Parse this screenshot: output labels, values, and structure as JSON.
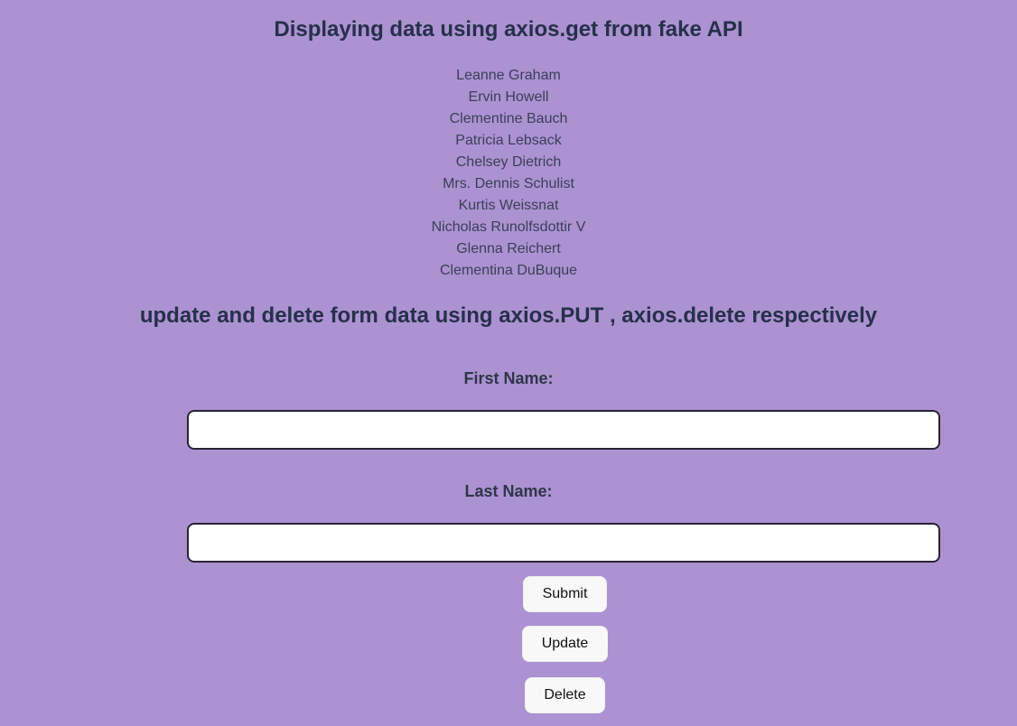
{
  "header": {
    "title": "Displaying data using axios.get from fake API"
  },
  "users": [
    "Leanne Graham",
    "Ervin Howell",
    "Clementine Bauch",
    "Patricia Lebsack",
    "Chelsey Dietrich",
    "Mrs. Dennis Schulist",
    "Kurtis Weissnat",
    "Nicholas Runolfsdottir V",
    "Glenna Reichert",
    "Clementina DuBuque"
  ],
  "form": {
    "title": "update and delete form data using axios.PUT , axios.delete respectively",
    "first_name_label": "First Name:",
    "first_name_value": "",
    "last_name_label": "Last Name:",
    "last_name_value": "",
    "submit_label": "Submit",
    "update_label": "Update",
    "delete_label": "Delete"
  },
  "colors": {
    "background": "#ab92d1",
    "heading": "#26304a",
    "button_bg": "#f8f8f8"
  }
}
